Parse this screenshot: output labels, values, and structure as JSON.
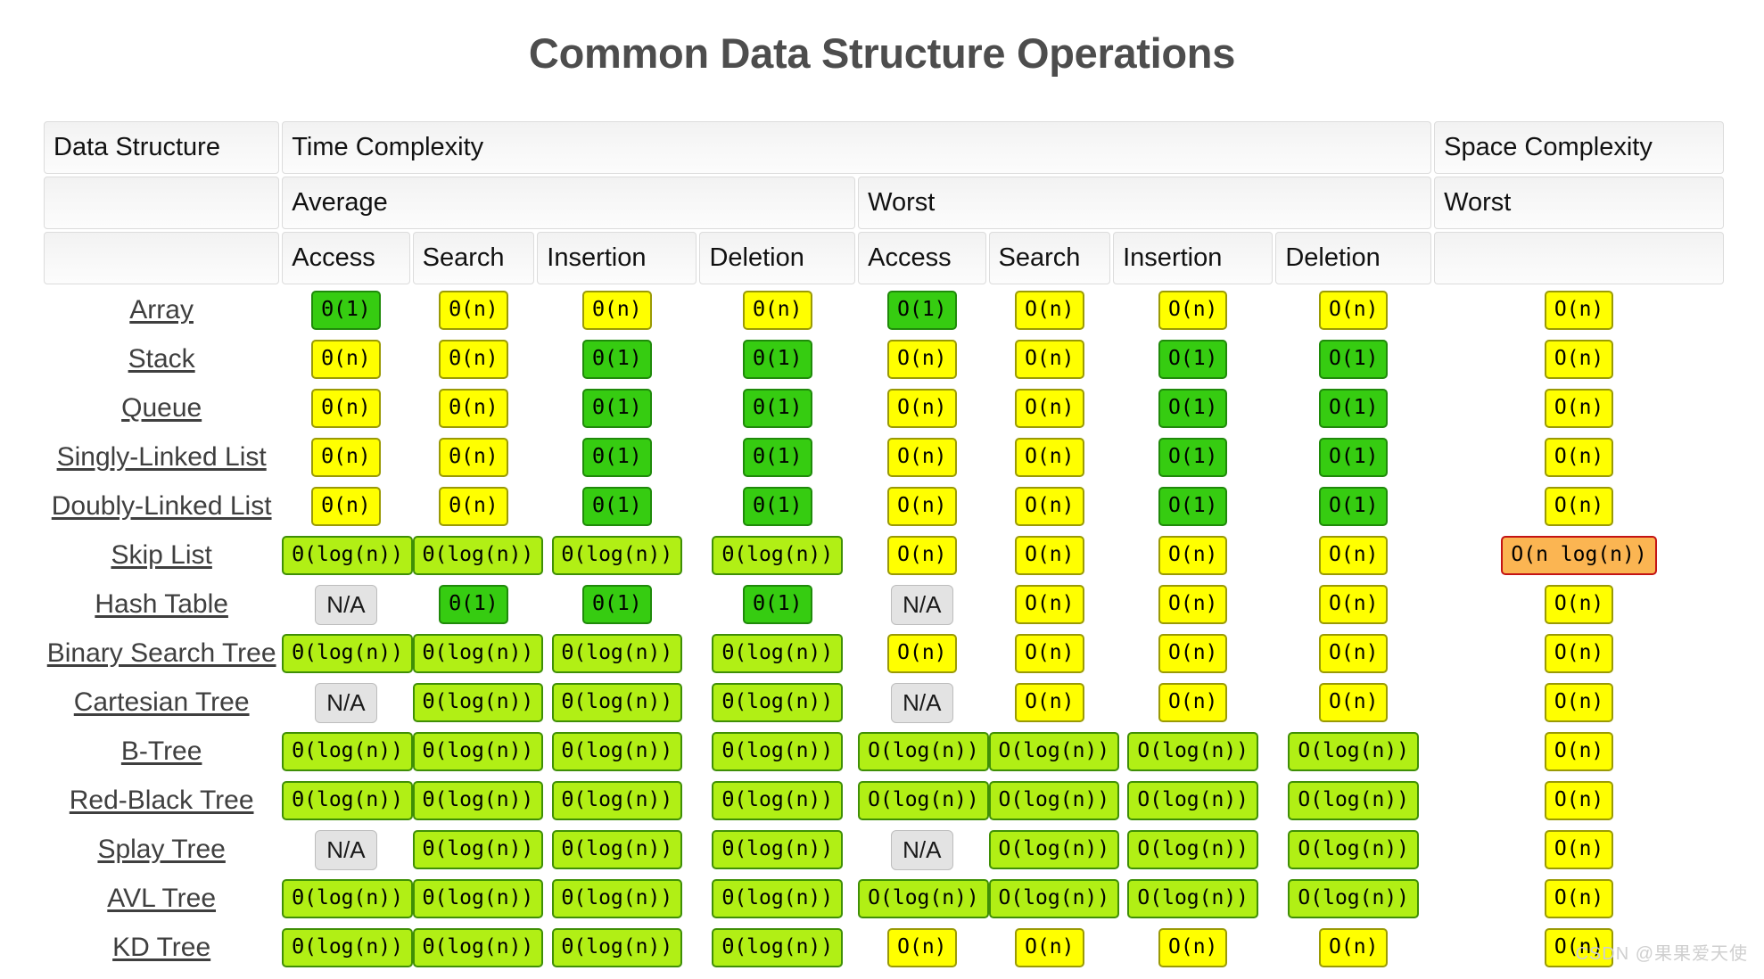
{
  "title": "Common Data Structure Operations",
  "watermark": "CSDN @果果爱天使",
  "header": {
    "data_structure": "Data Structure",
    "time_complexity": "Time Complexity",
    "space_complexity": "Space Complexity",
    "average": "Average",
    "worst": "Worst",
    "space_worst": "Worst",
    "ops": [
      "Access",
      "Search",
      "Insertion",
      "Deletion",
      "Access",
      "Search",
      "Insertion",
      "Deletion"
    ]
  },
  "legend_colors": {
    "constant": "#36cc11",
    "logarithmic": "#b1ef15",
    "linear": "#ffff00",
    "linearithmic": "#fbb552",
    "na": "#e3e3e3"
  },
  "rows": [
    {
      "name": "Array",
      "cells": [
        {
          "text": "Θ(1)",
          "kind": "green"
        },
        {
          "text": "Θ(n)",
          "kind": "yellow"
        },
        {
          "text": "Θ(n)",
          "kind": "yellow"
        },
        {
          "text": "Θ(n)",
          "kind": "yellow"
        },
        {
          "text": "O(1)",
          "kind": "green"
        },
        {
          "text": "O(n)",
          "kind": "yellow"
        },
        {
          "text": "O(n)",
          "kind": "yellow"
        },
        {
          "text": "O(n)",
          "kind": "yellow"
        },
        {
          "text": "O(n)",
          "kind": "yellow"
        }
      ]
    },
    {
      "name": "Stack",
      "cells": [
        {
          "text": "Θ(n)",
          "kind": "yellow"
        },
        {
          "text": "Θ(n)",
          "kind": "yellow"
        },
        {
          "text": "Θ(1)",
          "kind": "green"
        },
        {
          "text": "Θ(1)",
          "kind": "green"
        },
        {
          "text": "O(n)",
          "kind": "yellow"
        },
        {
          "text": "O(n)",
          "kind": "yellow"
        },
        {
          "text": "O(1)",
          "kind": "green"
        },
        {
          "text": "O(1)",
          "kind": "green"
        },
        {
          "text": "O(n)",
          "kind": "yellow"
        }
      ]
    },
    {
      "name": "Queue",
      "cells": [
        {
          "text": "Θ(n)",
          "kind": "yellow"
        },
        {
          "text": "Θ(n)",
          "kind": "yellow"
        },
        {
          "text": "Θ(1)",
          "kind": "green"
        },
        {
          "text": "Θ(1)",
          "kind": "green"
        },
        {
          "text": "O(n)",
          "kind": "yellow"
        },
        {
          "text": "O(n)",
          "kind": "yellow"
        },
        {
          "text": "O(1)",
          "kind": "green"
        },
        {
          "text": "O(1)",
          "kind": "green"
        },
        {
          "text": "O(n)",
          "kind": "yellow"
        }
      ]
    },
    {
      "name": "Singly-Linked List",
      "cells": [
        {
          "text": "Θ(n)",
          "kind": "yellow"
        },
        {
          "text": "Θ(n)",
          "kind": "yellow"
        },
        {
          "text": "Θ(1)",
          "kind": "green"
        },
        {
          "text": "Θ(1)",
          "kind": "green"
        },
        {
          "text": "O(n)",
          "kind": "yellow"
        },
        {
          "text": "O(n)",
          "kind": "yellow"
        },
        {
          "text": "O(1)",
          "kind": "green"
        },
        {
          "text": "O(1)",
          "kind": "green"
        },
        {
          "text": "O(n)",
          "kind": "yellow"
        }
      ]
    },
    {
      "name": "Doubly-Linked List",
      "cells": [
        {
          "text": "Θ(n)",
          "kind": "yellow"
        },
        {
          "text": "Θ(n)",
          "kind": "yellow"
        },
        {
          "text": "Θ(1)",
          "kind": "green"
        },
        {
          "text": "Θ(1)",
          "kind": "green"
        },
        {
          "text": "O(n)",
          "kind": "yellow"
        },
        {
          "text": "O(n)",
          "kind": "yellow"
        },
        {
          "text": "O(1)",
          "kind": "green"
        },
        {
          "text": "O(1)",
          "kind": "green"
        },
        {
          "text": "O(n)",
          "kind": "yellow"
        }
      ]
    },
    {
      "name": "Skip List",
      "cells": [
        {
          "text": "Θ(log(n))",
          "kind": "lime"
        },
        {
          "text": "Θ(log(n))",
          "kind": "lime"
        },
        {
          "text": "Θ(log(n))",
          "kind": "lime"
        },
        {
          "text": "Θ(log(n))",
          "kind": "lime"
        },
        {
          "text": "O(n)",
          "kind": "yellow"
        },
        {
          "text": "O(n)",
          "kind": "yellow"
        },
        {
          "text": "O(n)",
          "kind": "yellow"
        },
        {
          "text": "O(n)",
          "kind": "yellow"
        },
        {
          "text": "O(n log(n))",
          "kind": "orange"
        }
      ]
    },
    {
      "name": "Hash Table",
      "cells": [
        {
          "text": "N/A",
          "kind": "na"
        },
        {
          "text": "Θ(1)",
          "kind": "green"
        },
        {
          "text": "Θ(1)",
          "kind": "green"
        },
        {
          "text": "Θ(1)",
          "kind": "green"
        },
        {
          "text": "N/A",
          "kind": "na"
        },
        {
          "text": "O(n)",
          "kind": "yellow"
        },
        {
          "text": "O(n)",
          "kind": "yellow"
        },
        {
          "text": "O(n)",
          "kind": "yellow"
        },
        {
          "text": "O(n)",
          "kind": "yellow"
        }
      ]
    },
    {
      "name": "Binary Search Tree",
      "cells": [
        {
          "text": "Θ(log(n))",
          "kind": "lime"
        },
        {
          "text": "Θ(log(n))",
          "kind": "lime"
        },
        {
          "text": "Θ(log(n))",
          "kind": "lime"
        },
        {
          "text": "Θ(log(n))",
          "kind": "lime"
        },
        {
          "text": "O(n)",
          "kind": "yellow"
        },
        {
          "text": "O(n)",
          "kind": "yellow"
        },
        {
          "text": "O(n)",
          "kind": "yellow"
        },
        {
          "text": "O(n)",
          "kind": "yellow"
        },
        {
          "text": "O(n)",
          "kind": "yellow"
        }
      ]
    },
    {
      "name": "Cartesian Tree",
      "cells": [
        {
          "text": "N/A",
          "kind": "na"
        },
        {
          "text": "Θ(log(n))",
          "kind": "lime"
        },
        {
          "text": "Θ(log(n))",
          "kind": "lime"
        },
        {
          "text": "Θ(log(n))",
          "kind": "lime"
        },
        {
          "text": "N/A",
          "kind": "na"
        },
        {
          "text": "O(n)",
          "kind": "yellow"
        },
        {
          "text": "O(n)",
          "kind": "yellow"
        },
        {
          "text": "O(n)",
          "kind": "yellow"
        },
        {
          "text": "O(n)",
          "kind": "yellow"
        }
      ]
    },
    {
      "name": "B-Tree",
      "cells": [
        {
          "text": "Θ(log(n))",
          "kind": "lime"
        },
        {
          "text": "Θ(log(n))",
          "kind": "lime"
        },
        {
          "text": "Θ(log(n))",
          "kind": "lime"
        },
        {
          "text": "Θ(log(n))",
          "kind": "lime"
        },
        {
          "text": "O(log(n))",
          "kind": "lime"
        },
        {
          "text": "O(log(n))",
          "kind": "lime"
        },
        {
          "text": "O(log(n))",
          "kind": "lime"
        },
        {
          "text": "O(log(n))",
          "kind": "lime"
        },
        {
          "text": "O(n)",
          "kind": "yellow"
        }
      ]
    },
    {
      "name": "Red-Black Tree",
      "cells": [
        {
          "text": "Θ(log(n))",
          "kind": "lime"
        },
        {
          "text": "Θ(log(n))",
          "kind": "lime"
        },
        {
          "text": "Θ(log(n))",
          "kind": "lime"
        },
        {
          "text": "Θ(log(n))",
          "kind": "lime"
        },
        {
          "text": "O(log(n))",
          "kind": "lime"
        },
        {
          "text": "O(log(n))",
          "kind": "lime"
        },
        {
          "text": "O(log(n))",
          "kind": "lime"
        },
        {
          "text": "O(log(n))",
          "kind": "lime"
        },
        {
          "text": "O(n)",
          "kind": "yellow"
        }
      ]
    },
    {
      "name": "Splay Tree",
      "cells": [
        {
          "text": "N/A",
          "kind": "na"
        },
        {
          "text": "Θ(log(n))",
          "kind": "lime"
        },
        {
          "text": "Θ(log(n))",
          "kind": "lime"
        },
        {
          "text": "Θ(log(n))",
          "kind": "lime"
        },
        {
          "text": "N/A",
          "kind": "na"
        },
        {
          "text": "O(log(n))",
          "kind": "lime"
        },
        {
          "text": "O(log(n))",
          "kind": "lime"
        },
        {
          "text": "O(log(n))",
          "kind": "lime"
        },
        {
          "text": "O(n)",
          "kind": "yellow"
        }
      ]
    },
    {
      "name": "AVL Tree",
      "cells": [
        {
          "text": "Θ(log(n))",
          "kind": "lime"
        },
        {
          "text": "Θ(log(n))",
          "kind": "lime"
        },
        {
          "text": "Θ(log(n))",
          "kind": "lime"
        },
        {
          "text": "Θ(log(n))",
          "kind": "lime"
        },
        {
          "text": "O(log(n))",
          "kind": "lime"
        },
        {
          "text": "O(log(n))",
          "kind": "lime"
        },
        {
          "text": "O(log(n))",
          "kind": "lime"
        },
        {
          "text": "O(log(n))",
          "kind": "lime"
        },
        {
          "text": "O(n)",
          "kind": "yellow"
        }
      ]
    },
    {
      "name": "KD Tree",
      "cells": [
        {
          "text": "Θ(log(n))",
          "kind": "lime"
        },
        {
          "text": "Θ(log(n))",
          "kind": "lime"
        },
        {
          "text": "Θ(log(n))",
          "kind": "lime"
        },
        {
          "text": "Θ(log(n))",
          "kind": "lime"
        },
        {
          "text": "O(n)",
          "kind": "yellow"
        },
        {
          "text": "O(n)",
          "kind": "yellow"
        },
        {
          "text": "O(n)",
          "kind": "yellow"
        },
        {
          "text": "O(n)",
          "kind": "yellow"
        },
        {
          "text": "O(n)",
          "kind": "yellow"
        }
      ]
    }
  ]
}
